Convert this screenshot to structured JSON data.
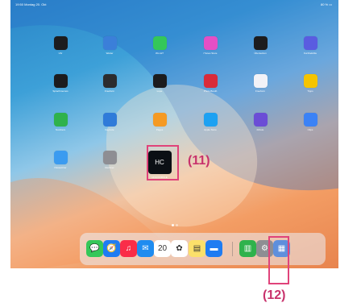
{
  "status_bar": {
    "time": "19:50  Montag 20. Okt",
    "battery": "80 % ▭"
  },
  "home_rows": [
    [
      {
        "label": "Uhr",
        "icon": "clock-icon",
        "bg": "#1c1c1e"
      },
      {
        "label": "Wetter",
        "icon": "weather-icon",
        "bg": "#3b7fd9"
      },
      {
        "label": "Wo ist?",
        "icon": "find-my-icon",
        "bg": "#34c759"
      },
      {
        "label": "iTunes Store",
        "icon": "itunes-store-icon",
        "bg": "#e44fc5"
      },
      {
        "label": "Übersetzen",
        "icon": "translate-icon",
        "bg": "#1c1c1e"
      },
      {
        "label": "Kurzbefehle",
        "icon": "shortcuts-icon",
        "bg": "#5a5ce0"
      }
    ],
    [
      {
        "label": "Sprachmemos",
        "icon": "voice-memos-icon",
        "bg": "#1c1c1e"
      },
      {
        "label": "Freeform",
        "icon": "stocks-icon",
        "bg": "#2c2c2e"
      },
      {
        "label": "Lupe",
        "icon": "magnifier-icon",
        "bg": "#1c1c1e"
      },
      {
        "label": "Photo Booth",
        "icon": "photo-booth-icon",
        "bg": "#d92b3a"
      },
      {
        "label": "Freeform",
        "icon": "freeform-icon",
        "bg": "#f2f2f7"
      },
      {
        "label": "Tipps",
        "icon": "tips-icon",
        "bg": "#f5c400"
      }
    ],
    [
      {
        "label": "Numbers",
        "icon": "numbers-icon",
        "bg": "#2fb24c"
      },
      {
        "label": "Keynote",
        "icon": "keynote-icon",
        "bg": "#2f7bd9"
      },
      {
        "label": "Pages",
        "icon": "pages-icon",
        "bg": "#f59a23"
      },
      {
        "label": "Apple Store",
        "icon": "apple-store-icon",
        "bg": "#1da1f2"
      },
      {
        "label": "iMovie",
        "icon": "imovie-icon",
        "bg": "#6b4dd6"
      },
      {
        "label": "Clips",
        "icon": "clips-icon",
        "bg": "#3b82f6"
      }
    ],
    [
      {
        "label": "Passwörter",
        "icon": "passwords-icon",
        "bg": "#3a9bf0"
      },
      {
        "label": "Rechner",
        "icon": "calculator-icon",
        "bg": "#8e8e93"
      },
      {
        "label": "HOLOCIRCLE",
        "icon": "holocircle-icon",
        "bg": "#0b0f14"
      }
    ]
  ],
  "dock": [
    {
      "name": "messages-icon",
      "bg": "#34c759",
      "glyph": "💬"
    },
    {
      "name": "safari-icon",
      "bg": "#1e7cf2",
      "glyph": "🧭"
    },
    {
      "name": "music-icon",
      "bg": "#fa2d48",
      "glyph": "♫"
    },
    {
      "name": "mail-icon",
      "bg": "#1f8cf0",
      "glyph": "✉"
    },
    {
      "name": "calendar-icon",
      "bg": "#ffffff",
      "glyph": "20"
    },
    {
      "name": "photos-icon",
      "bg": "#ffffff",
      "glyph": "✿"
    },
    {
      "name": "notes-icon",
      "bg": "#fbe06a",
      "glyph": "▤"
    },
    {
      "name": "files-icon",
      "bg": "#1f7cf2",
      "glyph": "▬"
    },
    {
      "name": "numbers-dock-icon",
      "bg": "#2fb24c",
      "glyph": "▥"
    },
    {
      "name": "settings-icon",
      "bg": "#8e8e93",
      "glyph": "⚙"
    },
    {
      "name": "app-library-icon",
      "bg": "#5e8fdc",
      "glyph": "▦"
    }
  ],
  "page_dots": 2,
  "annotations": {
    "a11": "(11)",
    "a12": "(12)"
  }
}
